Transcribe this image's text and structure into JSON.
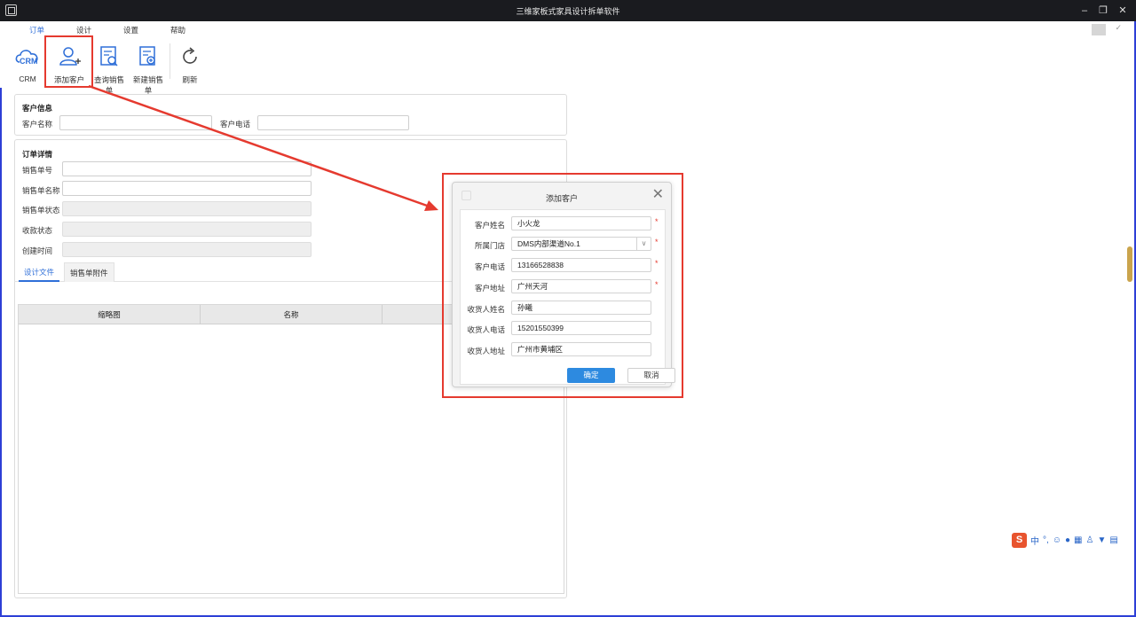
{
  "window": {
    "title": "三维家板式家具设计拆单软件"
  },
  "menu": {
    "tabs": [
      "订单",
      "设计",
      "设置",
      "帮助"
    ]
  },
  "ribbon": {
    "crm": "CRM",
    "add_customer": "添加客户",
    "query_order": "查询销售单",
    "new_order": "新建销售单",
    "refresh": "刷新"
  },
  "customer_info": {
    "title": "客户信息",
    "name_label": "客户名称",
    "phone_label": "客户电话"
  },
  "order_detail": {
    "title": "订单详情",
    "fields": [
      "销售单号",
      "销售单名称",
      "销售单状态",
      "收款状态",
      "创建时间"
    ]
  },
  "subtabs": [
    "设计文件",
    "销售单附件"
  ],
  "grid": {
    "columns": [
      "缩略图",
      "名称"
    ]
  },
  "dialog": {
    "title": "添加客户",
    "fields": [
      {
        "label": "客户姓名",
        "value": "小火龙",
        "required": "*"
      },
      {
        "label": "所属门店",
        "value": "DMS内部渠道No.1",
        "required": "*"
      },
      {
        "label": "客户电话",
        "value": "13166528838",
        "required": "*"
      },
      {
        "label": "客户地址",
        "value": "广州天河",
        "required": "*"
      },
      {
        "label": "收货人姓名",
        "value": "孙曦"
      },
      {
        "label": "收货人电话",
        "value": "15201550399"
      },
      {
        "label": "收货人地址",
        "value": "广州市黄埔区"
      }
    ],
    "ok": "确定",
    "cancel": "取消"
  },
  "ime": {
    "logo": "S",
    "mode": "中"
  },
  "colors": {
    "accent": "#2f6fd8",
    "highlight": "#e53a2f",
    "titlebar": "#1a1b1f"
  }
}
